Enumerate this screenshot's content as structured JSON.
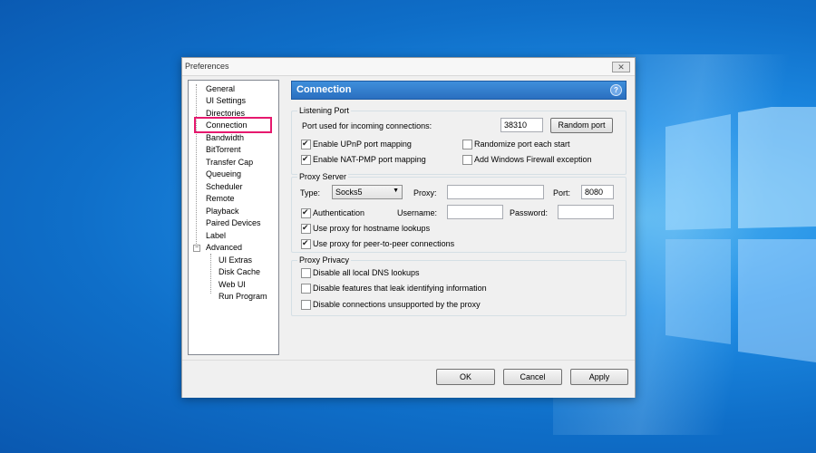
{
  "window": {
    "title": "Preferences",
    "close_glyph": "✕"
  },
  "colors": {
    "header_bg": "#2f7dd0",
    "selection_outline": "#e6196e",
    "desktop": "#1f8ee6"
  },
  "tree": {
    "items": [
      "General",
      "UI Settings",
      "Directories",
      "Connection",
      "Bandwidth",
      "BitTorrent",
      "Transfer Cap",
      "Queueing",
      "Scheduler",
      "Remote",
      "Playback",
      "Paired Devices",
      "Label",
      "Advanced"
    ],
    "selected": "Connection",
    "advanced_children": [
      "UI Extras",
      "Disk Cache",
      "Web UI",
      "Run Program"
    ],
    "expander": "−"
  },
  "header": {
    "title": "Connection",
    "help_glyph": "?"
  },
  "listening": {
    "label": "Listening Port",
    "port_label": "Port used for incoming connections:",
    "port_value": "38310",
    "random_button": "Random port",
    "upnp": "Enable UPnP port mapping",
    "natpmp": "Enable NAT-PMP port mapping",
    "randomize": "Randomize port each start",
    "firewall": "Add Windows Firewall exception"
  },
  "proxy": {
    "label": "Proxy Server",
    "type_label": "Type:",
    "type_value": "Socks5",
    "proxy_label": "Proxy:",
    "proxy_value": "",
    "port_label": "Port:",
    "port_value": "8080",
    "auth": "Authentication",
    "username_label": "Username:",
    "username_value": "",
    "password_label": "Password:",
    "password_value": "",
    "hostname": "Use proxy for hostname lookups",
    "p2p": "Use proxy for peer-to-peer connections"
  },
  "privacy": {
    "label": "Proxy Privacy",
    "dns": "Disable all local DNS lookups",
    "leak": "Disable features that leak identifying information",
    "unsupported": "Disable connections unsupported by the proxy"
  },
  "footer": {
    "ok": "OK",
    "cancel": "Cancel",
    "apply": "Apply"
  }
}
